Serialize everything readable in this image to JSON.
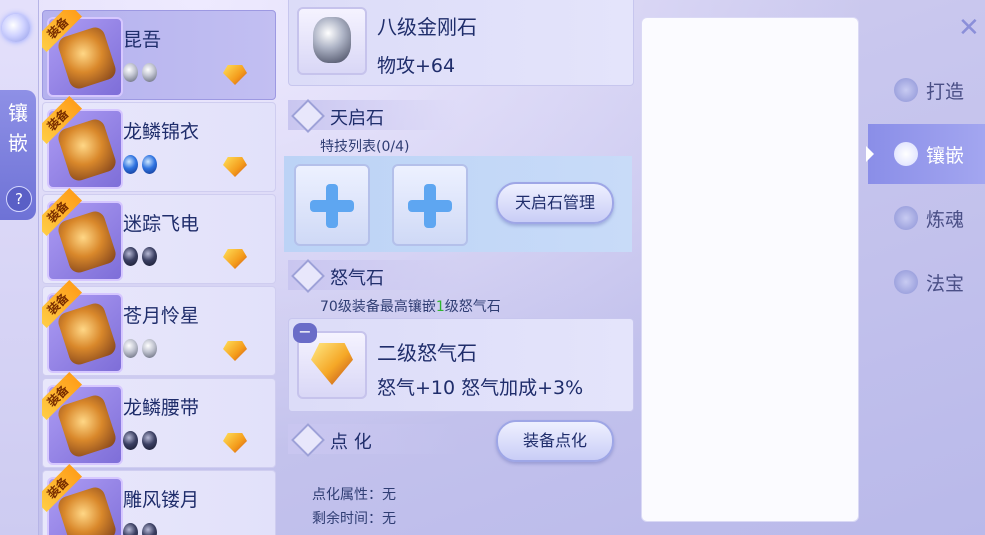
{
  "left_tab": {
    "label": "镶嵌",
    "help": "?"
  },
  "equipment": [
    {
      "name": "昆吾",
      "badge": "装备",
      "gems": [
        "silver",
        "silver"
      ],
      "selected": true
    },
    {
      "name": "龙鳞锦衣",
      "badge": "装备",
      "gems": [
        "blue",
        "blue"
      ],
      "selected": false
    },
    {
      "name": "迷踪飞电",
      "badge": "装备",
      "gems": [
        "dark",
        "dark"
      ],
      "selected": false
    },
    {
      "name": "苍月怜星",
      "badge": "装备",
      "gems": [
        "silver",
        "silver"
      ],
      "selected": false
    },
    {
      "name": "龙鳞腰带",
      "badge": "装备",
      "gems": [
        "dark",
        "dark"
      ],
      "selected": false
    },
    {
      "name": "雕风镂月",
      "badge": "装备",
      "gems": [
        "dark",
        "dark"
      ],
      "selected": false
    }
  ],
  "detail": {
    "top_gem": {
      "name": "八级金刚石",
      "stat": "物攻+64"
    },
    "tianqi": {
      "title": "天启石",
      "list_label": "特技列表(0/4)",
      "manage_button": "天启石管理"
    },
    "fury": {
      "title": "怒气石",
      "note_prefix": "70级装备最高镶嵌",
      "note_highlight": "1",
      "note_suffix": "级怒气石",
      "gem": {
        "name": "二级怒气石",
        "stat": "怒气+10   怒气加成+3%",
        "minus": "−"
      }
    },
    "dianhua": {
      "title": "点 化",
      "button": "装备点化",
      "attr_label": "点化属性：无",
      "time_label": "剩余时间：无"
    }
  },
  "right_nav": {
    "close": "✕",
    "items": [
      {
        "label": "打造",
        "icon": "forge-icon",
        "active": false
      },
      {
        "label": "镶嵌",
        "icon": "gem-icon",
        "active": true
      },
      {
        "label": "炼魂",
        "icon": "soul-icon",
        "active": false
      },
      {
        "label": "法宝",
        "icon": "treasure-icon",
        "active": false
      }
    ]
  },
  "colors": {
    "accent": "#8a8ee8",
    "text": "#1f2d6b",
    "highlight_green": "#2fb52f"
  }
}
